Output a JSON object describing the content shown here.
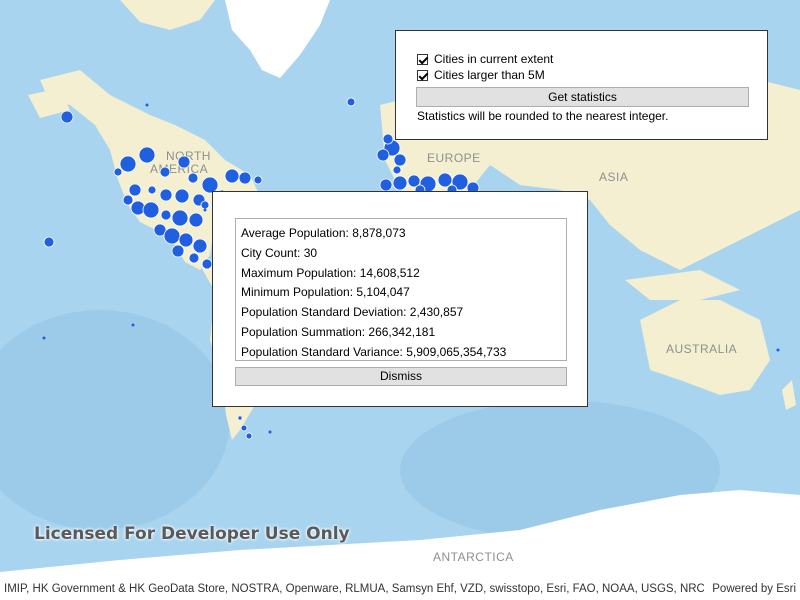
{
  "map": {
    "labels": {
      "north_america_line1": "NORTH",
      "north_america_line2": "AMERICA",
      "europe": "EUROPE",
      "asia": "ASIA",
      "australia": "AUSTRALIA",
      "antarctica": "ANTARCTICA"
    },
    "colors": {
      "ocean": "#a9d4ef",
      "land": "#f3efd0",
      "ice": "#ffffff",
      "city_marker": "#1f5fe0"
    },
    "watermark": "Licensed For Developer Use Only",
    "attribution": "IMIP, HK Government & HK GeoData Store, NOSTRA, Openware, RLMUA, Samsyn Ehf, VZD, swisstopo, Esri, FAO, NOAA, USGS, NRC...",
    "powered_by": "Powered by Esri"
  },
  "options": {
    "checkbox_extent_label": "Cities in current extent",
    "checkbox_extent_checked": true,
    "checkbox_large_label": "Cities larger than 5M",
    "checkbox_large_checked": true,
    "get_statistics_label": "Get statistics",
    "note": "Statistics will be rounded to the nearest integer."
  },
  "results": {
    "rows": [
      "Average Population: 8,878,073",
      "City Count: 30",
      "Maximum Population: 14,608,512",
      "Minimum Population: 5,104,047",
      "Population Standard Deviation: 2,430,857",
      "Population Summation: 266,342,181",
      "Population Standard Variance: 5,909,065,354,733"
    ],
    "dismiss_label": "Dismiss"
  }
}
